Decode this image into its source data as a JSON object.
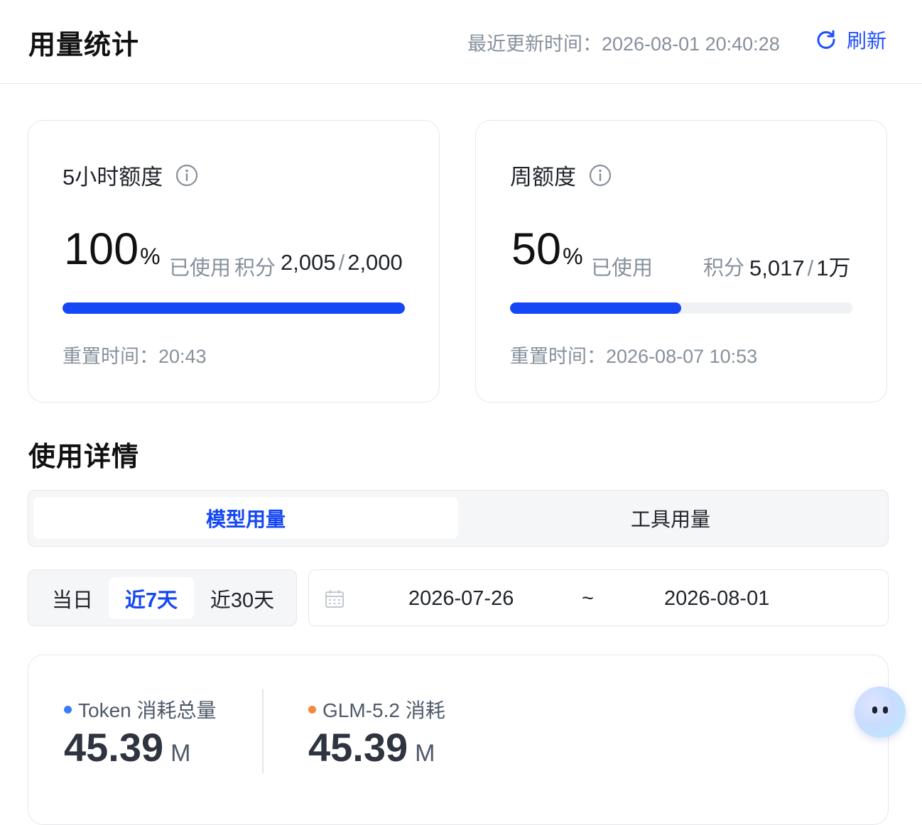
{
  "header": {
    "title": "用量统计",
    "last_updated": "最近更新时间：2026-08-01 20:40:28",
    "refresh_label": "刷新"
  },
  "quota_cards": [
    {
      "title": "5小时额度",
      "percent": "100",
      "percent_unit": "%",
      "used_label": "已使用",
      "points_label": "积分",
      "points_used": "2,005",
      "points_sep": "/",
      "points_total": "2,000",
      "progress": 1.0,
      "reset": "重置时间：20:43"
    },
    {
      "title": "周额度",
      "percent": "50",
      "percent_unit": "%",
      "used_label": "已使用",
      "points_label": "积分",
      "points_used": "5,017",
      "points_sep": "/",
      "points_total": "1万",
      "progress": 0.5,
      "reset": "重置时间：2026-08-07 10:53"
    }
  ],
  "details": {
    "title": "使用详情",
    "tabs": [
      "模型用量",
      "工具用量"
    ],
    "active_tab": "模型用量",
    "ranges": [
      "当日",
      "近7天",
      "近30天"
    ],
    "active_range": "近7天",
    "date_start": "2026-07-26",
    "date_sep": "~",
    "date_end": "2026-08-01"
  },
  "stats": [
    {
      "label": "Token 消耗总量",
      "value": "45.39",
      "unit": "M",
      "dot_color": "#3b7cf5"
    },
    {
      "label": "GLM-5.2 消耗",
      "value": "45.39",
      "unit": "M",
      "dot_color": "#f5893b"
    }
  ],
  "colors": {
    "accent": "#1447f5",
    "muted": "#86909c"
  },
  "icons": {
    "refresh": "refresh-icon",
    "info": "info-icon",
    "calendar": "calendar-icon",
    "assistant": "assistant-bubble"
  }
}
